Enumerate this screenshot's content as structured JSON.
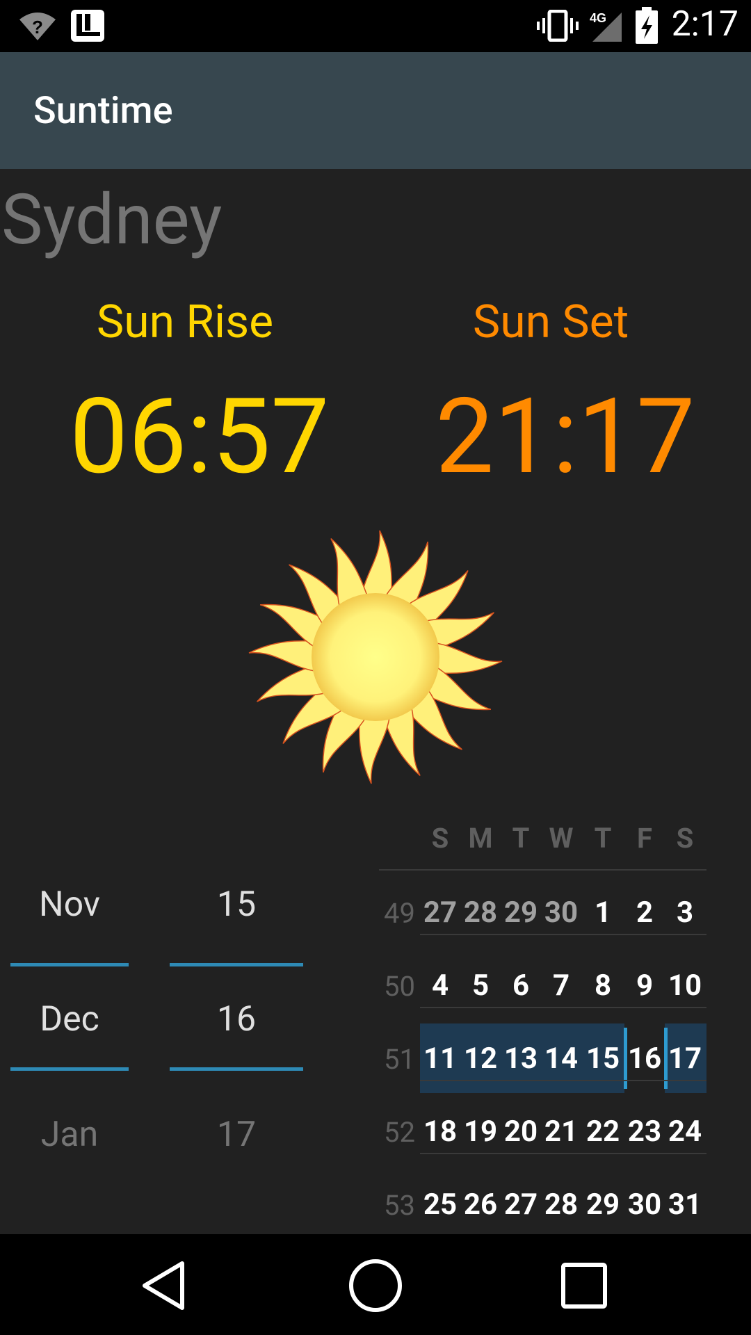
{
  "status_bar": {
    "time": "2:17",
    "network": "4G"
  },
  "app": {
    "title": "Suntime"
  },
  "location": {
    "city": "Sydney"
  },
  "sunrise": {
    "label": "Sun Rise",
    "time": "06:57",
    "color": "#ffd600"
  },
  "sunset": {
    "label": "Sun Set",
    "time": "21:17",
    "color": "#ff8a00"
  },
  "picker": {
    "months": [
      "Nov",
      "Dec",
      "Jan"
    ],
    "days": [
      "15",
      "16",
      "17"
    ]
  },
  "calendar": {
    "weekdays": [
      "S",
      "M",
      "T",
      "W",
      "T",
      "F",
      "S"
    ],
    "weeks": [
      {
        "num": "49",
        "days": [
          "27",
          "28",
          "29",
          "30",
          "1",
          "2",
          "3"
        ]
      },
      {
        "num": "50",
        "days": [
          "4",
          "5",
          "6",
          "7",
          "8",
          "9",
          "10"
        ]
      },
      {
        "num": "51",
        "days": [
          "11",
          "12",
          "13",
          "14",
          "15",
          "16",
          "17"
        ]
      },
      {
        "num": "52",
        "days": [
          "18",
          "19",
          "20",
          "21",
          "22",
          "23",
          "24"
        ]
      },
      {
        "num": "53",
        "days": [
          "25",
          "26",
          "27",
          "28",
          "29",
          "30",
          "31"
        ]
      }
    ],
    "selected_week": "51",
    "selected_day": "16",
    "highlight_color": "#1e3a52"
  },
  "icons": [
    "wifi-icon",
    "launcher-icon",
    "vibrate-icon",
    "signal-icon",
    "battery-icon",
    "back-icon",
    "home-icon",
    "recents-icon",
    "sun-icon"
  ]
}
